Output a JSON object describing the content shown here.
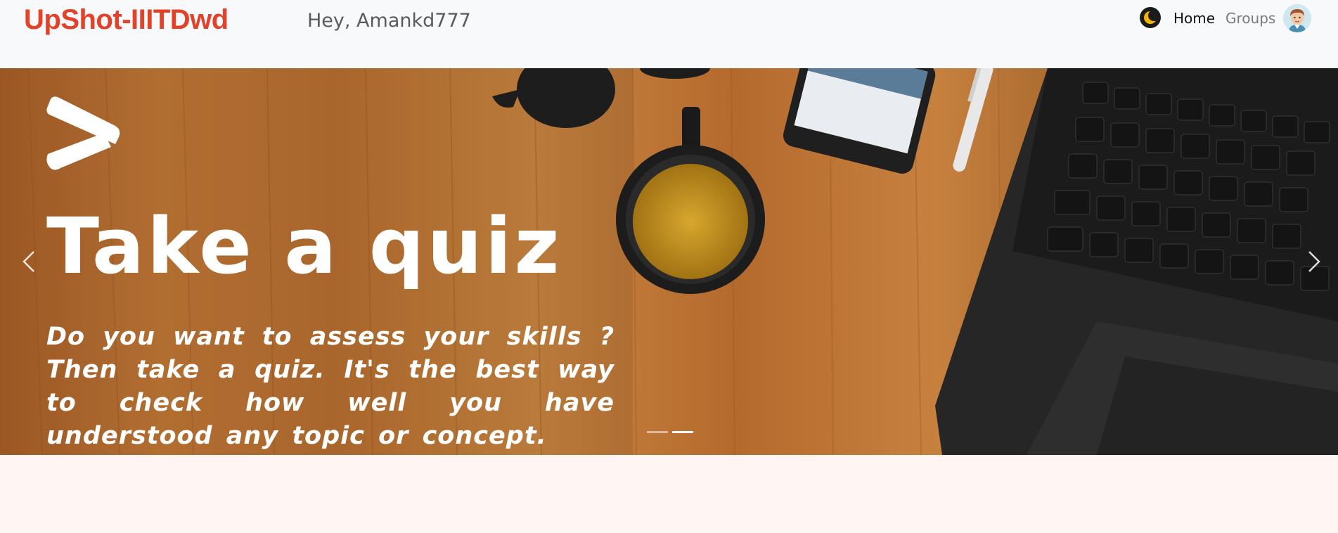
{
  "navbar": {
    "brand": "UpShot-IIITDwd",
    "greeting": "Hey, Amankd777",
    "theme_icon": "moon-icon",
    "links": [
      {
        "label": "Home",
        "active": true
      },
      {
        "label": "Groups",
        "active": false
      }
    ],
    "avatar_icon": "user-avatar-icon"
  },
  "hero": {
    "title": "Take a quiz",
    "text": "Do you want to assess your skills ? Then take a quiz. It's the best way to check how well you have understood any topic or concept.",
    "prev_icon": "chevron-left-icon",
    "next_icon": "chevron-right-icon",
    "slides_count": 2,
    "active_slide": 2
  },
  "colors": {
    "brand": "#e2412a",
    "navbar_bg": "#f8f9fa",
    "page_bg": "#fff6f4"
  }
}
